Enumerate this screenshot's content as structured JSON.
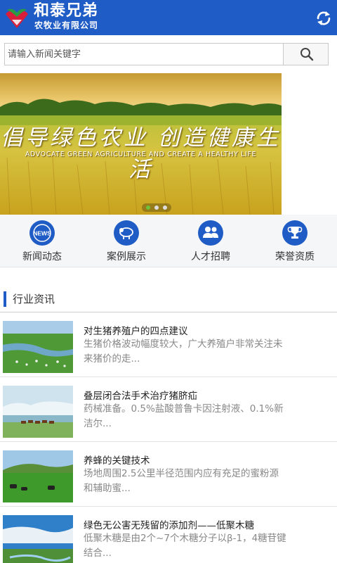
{
  "header": {
    "brand_title": "和泰兄弟",
    "brand_subtitle": "农牧业有限公司",
    "brand_color": "#1f5cc5",
    "refresh_icon": "refresh-icon"
  },
  "search": {
    "placeholder": "请输入新闻关键字",
    "value": "",
    "button_icon": "search-icon"
  },
  "banner": {
    "slogan": "倡导绿色农业  创造健康生活",
    "slogan_en": "ADVOCATE GREEN AGRICULTURE AND CREATE A HEALTHY LIFE",
    "slide_count": 3,
    "active_slide": 1
  },
  "quicknav": [
    {
      "label": "新闻动态",
      "icon": "news-icon"
    },
    {
      "label": "案例展示",
      "icon": "sheep-icon"
    },
    {
      "label": "人才招聘",
      "icon": "people-icon"
    },
    {
      "label": "荣誉资质",
      "icon": "trophy-icon"
    }
  ],
  "section": {
    "title": "行业资讯"
  },
  "news": [
    {
      "title": "对生猪养殖户的四点建议",
      "desc": "生猪价格波动幅度较大，广大养殖户非常关注未来猪价的走..."
    },
    {
      "title": "叠层闭合法手术治疗猪脐疝",
      "desc": "药械准备。0.5%盐酸普鲁卡因注射液、0.1%新洁尔..."
    },
    {
      "title": "养蜂的关键技术",
      "desc": "场地周围2.5公里半径范围内应有充足的蜜粉源和辅助蜜..."
    },
    {
      "title": "绿色无公害无残留的添加剂——低聚木糖",
      "desc": "低聚木糖是由2个~7个木糖分子以β-1，4糖苷键结合..."
    }
  ]
}
